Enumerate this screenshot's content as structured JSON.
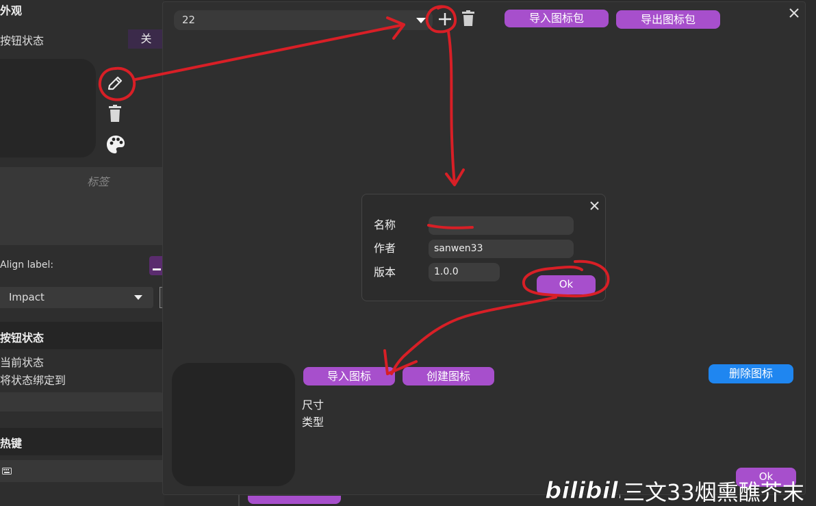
{
  "left_panel": {
    "appearance_title": "外观",
    "button_state_label": "按钮状态",
    "toggle_value": "关",
    "label_placeholder": "标签",
    "align_label": "Align label:",
    "font_value": "Impact",
    "button_state_section": "按钮状态",
    "current_state": "当前状态",
    "bind_state_to": "将状态绑定到",
    "hotkey_section": "热键"
  },
  "main_dialog": {
    "pack_value": "22",
    "import_pack_label": "导入图标包",
    "export_pack_label": "导出图标包",
    "import_icon_label": "导入图标",
    "create_icon_label": "创建图标",
    "delete_icon_label": "删除图标",
    "size_label": "尺寸",
    "type_label": "类型",
    "ok_label": "Ok"
  },
  "sub_dialog": {
    "name_label": "名称",
    "name_value": "",
    "author_label": "作者",
    "author_value": "sanwen33",
    "version_label": "版本",
    "version_value": "1.0.0",
    "ok_label": "Ok"
  },
  "watermark": {
    "logo_text": "bilibili",
    "channel": "三文33烟熏醮芥末"
  },
  "colors": {
    "purple_button": "#a74fcc",
    "blue_button": "#1f86f0",
    "annotation_red": "#d81f26"
  }
}
